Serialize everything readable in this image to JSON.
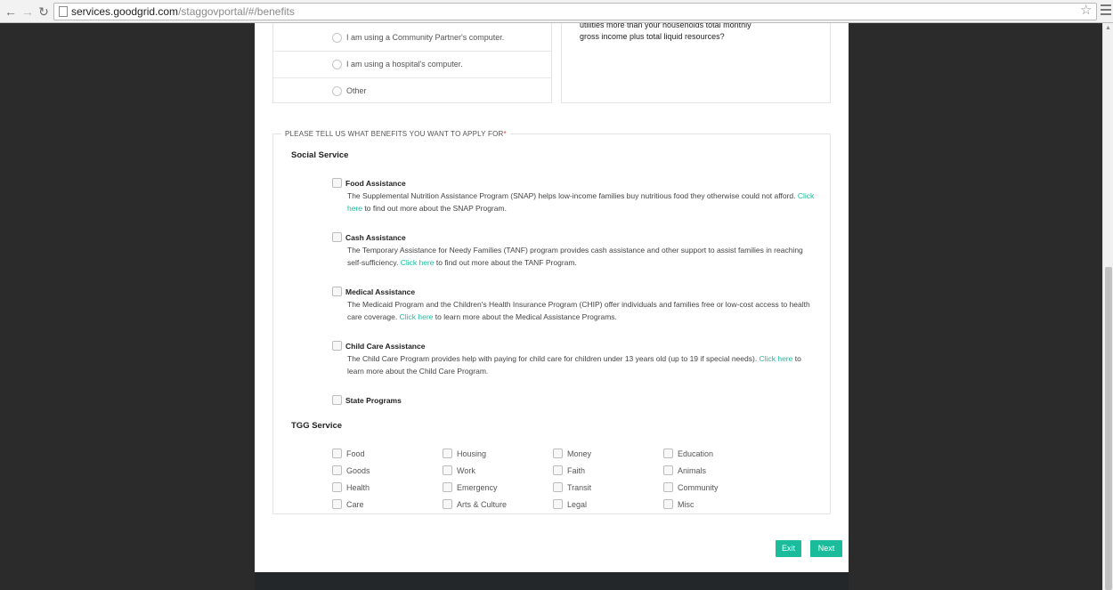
{
  "browser": {
    "url_host": "services.goodgrid.com",
    "url_path": "/staggovportal/#/benefits"
  },
  "prev_question": {
    "radio_options": [
      "I am using a Community Partner's computer.",
      "I am using a hospital's computer.",
      "Other"
    ],
    "question_text": "Is your household's monthly rent/mortgage plus utilities more than your households total monthly gross income plus total liquid resources?"
  },
  "benefits": {
    "legend": "PLEASE TELL US WHAT BENEFITS YOU WANT TO APPLY FOR",
    "required_mark": "*",
    "social_service": {
      "title": "Social Service",
      "items": [
        {
          "title": "Food Assistance",
          "desc_before": "The Supplemental Nutrition Assistance Program (SNAP) helps low-income families buy nutritious food they otherwise could not afford.",
          "link": "Click here",
          "desc_after": "to find out more about the SNAP Program."
        },
        {
          "title": "Cash Assistance",
          "desc_before": "The Temporary Assistance for Needy Families (TANF) program provides cash assistance and other support to assist families in reaching self-sufficiency.",
          "link": "Click here",
          "desc_after": "to find out more about the TANF Program."
        },
        {
          "title": "Medical Assistance",
          "desc_before": "The Medicaid Program and the Children's Health Insurance Program (CHIP) offer individuals and families free or low-cost access to health care coverage.",
          "link": "Click here",
          "desc_after": "to learn more about the Medical Assistance Programs."
        },
        {
          "title": "Child Care Assistance",
          "desc_before": "The Child Care Program provides help with paying for child care for children under 13 years old (up to 19 if special needs).",
          "link": "Click here",
          "desc_after": "to learn more about the Child Care Program."
        },
        {
          "title": "State Programs",
          "desc_before": "",
          "link": "",
          "desc_after": ""
        }
      ]
    },
    "tgg_service": {
      "title": "TGG Service",
      "columns": [
        [
          "Food",
          "Goods",
          "Health",
          "Care"
        ],
        [
          "Housing",
          "Work",
          "Emergency",
          "Arts & Culture"
        ],
        [
          "Money",
          "Faith",
          "Transit",
          "Legal"
        ],
        [
          "Education",
          "Animals",
          "Community",
          "Misc"
        ]
      ]
    }
  },
  "buttons": {
    "exit": "Exit",
    "next": "Next"
  },
  "colors": {
    "accent": "#1abc9c",
    "required": "#e53935",
    "background": "#2b2b2b"
  }
}
